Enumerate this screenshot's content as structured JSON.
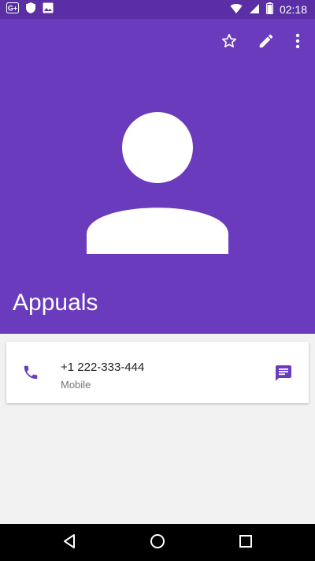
{
  "statusbar": {
    "time": "02:18"
  },
  "header": {
    "background_color": "#6a3bbd",
    "toolbar": {
      "favorite_icon": "star-outline-icon",
      "edit_icon": "pencil-icon",
      "more_icon": "more-vert-icon"
    },
    "contact_name": "Appuals",
    "avatar_icon": "person-placeholder-icon"
  },
  "phone_card": {
    "number": "+1 222-333-444",
    "type": "Mobile",
    "call_icon": "phone-icon",
    "message_icon": "message-icon",
    "accent_color": "#6a3bbd"
  },
  "navbar": {
    "back_icon": "back-icon",
    "home_icon": "home-icon",
    "recents_icon": "recents-icon"
  }
}
